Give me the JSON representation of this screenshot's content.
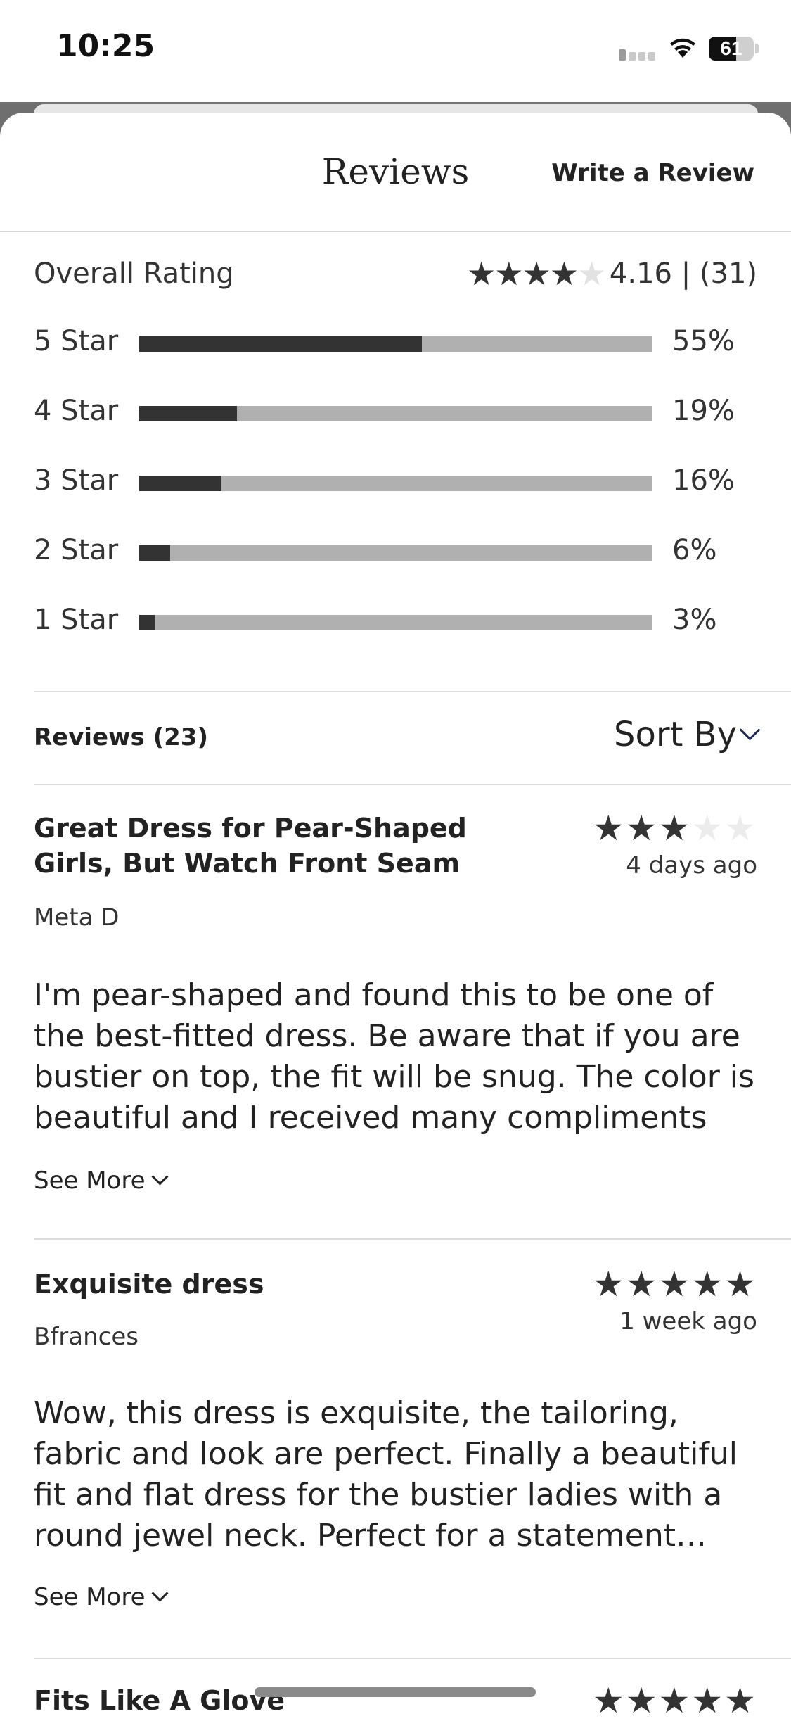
{
  "status_bar": {
    "time": "10:25",
    "battery": "61",
    "battery_level": 0.61,
    "icons": [
      "cellular-signal-icon",
      "wifi-icon",
      "battery-icon"
    ]
  },
  "header": {
    "title": "Reviews",
    "write_review": "Write a Review"
  },
  "overall": {
    "label": "Overall Rating",
    "rating": 4.16,
    "value_text": "4.16 | (31)",
    "stars": "★★★★★"
  },
  "distribution": [
    {
      "label": "5 Star",
      "percent": 55,
      "percent_text": "55%"
    },
    {
      "label": "4 Star",
      "percent": 19,
      "percent_text": "19%"
    },
    {
      "label": "3 Star",
      "percent": 16,
      "percent_text": "16%"
    },
    {
      "label": "2 Star",
      "percent": 6,
      "percent_text": "6%"
    },
    {
      "label": "1 Star",
      "percent": 3,
      "percent_text": "3%"
    }
  ],
  "reviews_header": {
    "count": "Reviews (23)",
    "sort": "Sort By"
  },
  "reviews": [
    {
      "title": "Great Dress for Pear-Shaped Girls, But Watch Front Seam",
      "rating": 3,
      "date": "4 days ago",
      "author": "Meta D",
      "body": "I'm pear-shaped and found this to be one of the best-fitted dress. Be aware that if you are bustier on top, the fit will be snug. The color is beautiful and I received many compliments",
      "see_more": "See More"
    },
    {
      "title": "Exquisite dress",
      "rating": 5,
      "date": "1 week ago",
      "author": "Bfrances",
      "body": "Wow, this dress is exquisite, the tailoring, fabric and look are perfect. Finally a beautiful fit and flat dress for the bustier ladies with a round jewel neck. Perfect for a statement necklace",
      "see_more": "See More"
    },
    {
      "title": "Fits Like A Glove",
      "rating": 5
    }
  ],
  "colors": {
    "bar_fill": "#333333",
    "bar_track": "#b0b0b0",
    "text": "#222222",
    "divider": "#dcdcdc"
  }
}
